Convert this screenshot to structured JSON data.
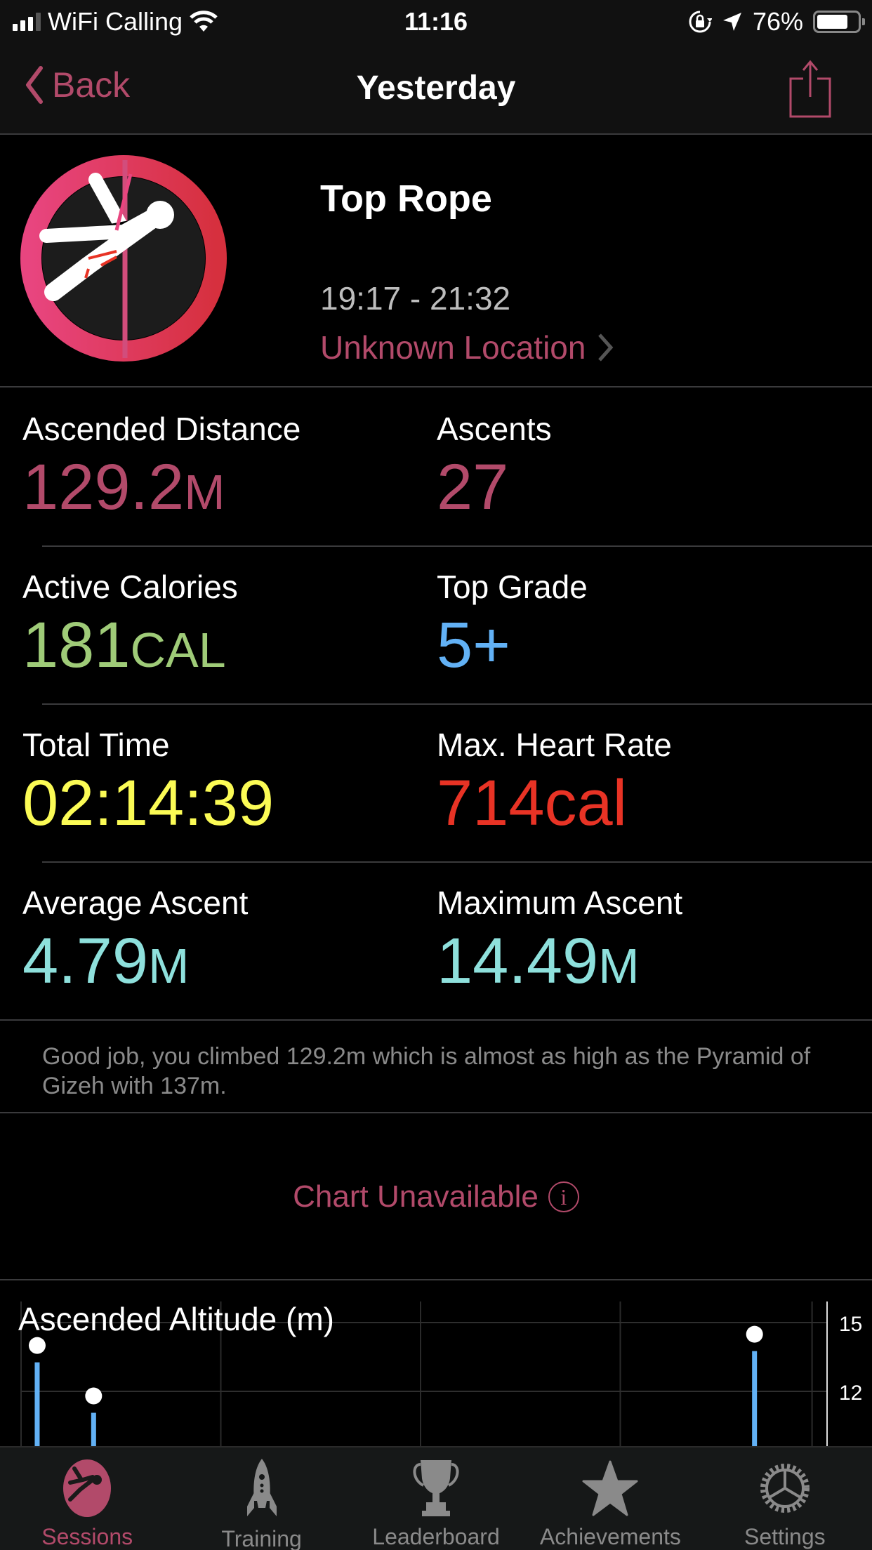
{
  "status_bar": {
    "carrier": "WiFi Calling",
    "time": "11:16",
    "battery_percent": "76%",
    "battery_level": 0.76
  },
  "nav": {
    "back_label": "Back",
    "title": "Yesterday"
  },
  "session": {
    "type": "Top Rope",
    "time_range": "19:17 - 21:32",
    "location": "Unknown Location"
  },
  "stats": [
    {
      "left": {
        "label": "Ascended Distance",
        "value": "129.2",
        "unit": "M",
        "color": "#b24a6a"
      },
      "right": {
        "label": "Ascents",
        "value": "27",
        "unit": "",
        "color": "#b24a6a"
      }
    },
    {
      "left": {
        "label": "Active Calories",
        "value": "181",
        "unit": "CAL",
        "color": "#9fcb78"
      },
      "right": {
        "label": "Top Grade",
        "value": "5+",
        "unit": "",
        "color": "#62b1f5"
      }
    },
    {
      "left": {
        "label": "Total Time",
        "value": "02:14:39",
        "unit": "",
        "color": "#fbfb55"
      },
      "right": {
        "label": "Max. Heart Rate",
        "value": "714cal",
        "unit": "",
        "color": "#e83325"
      }
    },
    {
      "left": {
        "label": "Average Ascent",
        "value": "4.79",
        "unit": "M",
        "color": "#8ee0dc"
      },
      "right": {
        "label": "Maximum Ascent",
        "value": "14.49",
        "unit": "M",
        "color": "#8ee0dc"
      }
    }
  ],
  "note": "Good job, you climbed 129.2m which is almost as high as the Pyramid of Gizeh with 137m.",
  "chart_unavailable": {
    "label": "Chart Unavailable",
    "icon": "info-icon"
  },
  "chart_data": {
    "type": "bar",
    "title": "Ascended Altitude (m)",
    "xlabel": "",
    "ylabel": "m",
    "y_ticks": [
      12,
      15
    ],
    "grid": true,
    "y_axis_side": "right",
    "visible_ylim": [
      10,
      16
    ],
    "points": [
      {
        "x": 0.02,
        "value": 14.0
      },
      {
        "x": 0.09,
        "value": 11.8
      },
      {
        "x": 0.91,
        "value": 14.49
      }
    ],
    "bar_color": "#62b1f5",
    "marker_color": "#ffffff"
  },
  "tabbar": {
    "tabs": [
      {
        "label": "Sessions",
        "icon": "climber-icon",
        "active": true
      },
      {
        "label": "Training",
        "icon": "rocket-icon",
        "active": false
      },
      {
        "label": "Leaderboard",
        "icon": "trophy-icon",
        "active": false
      },
      {
        "label": "Achievements",
        "icon": "star-icon",
        "active": false
      },
      {
        "label": "Settings",
        "icon": "gear-icon",
        "active": false
      }
    ]
  },
  "colors": {
    "accent": "#b24a6a",
    "background": "#000000",
    "bar_background": "#111111",
    "divider": "#3a3a3c"
  }
}
